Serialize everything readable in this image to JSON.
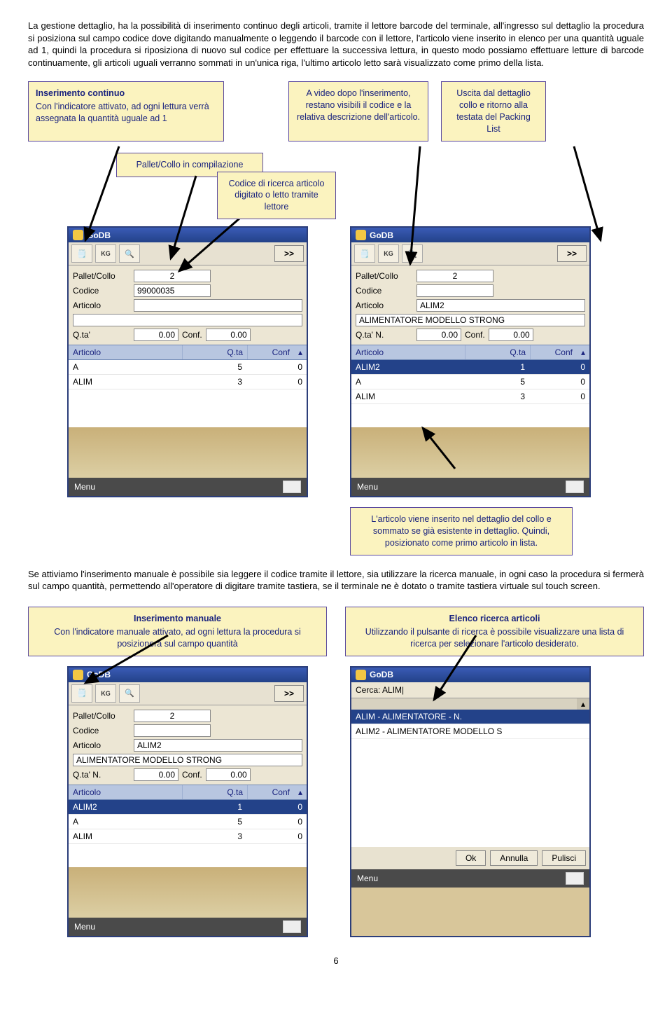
{
  "para1": "La gestione dettaglio, ha la possibilità di inserimento continuo degli articoli, tramite il lettore barcode del terminale, all'ingresso sul dettaglio la procedura si posiziona sul campo codice dove digitando manualmente o leggendo il barcode con il lettore, l'articolo viene inserito in elenco per una quantità uguale ad 1, quindi la procedura si riposiziona di nuovo sul codice per effettuare la successiva lettura, in questo modo possiamo effettuare letture di barcode continuamente, gli articoli uguali verranno sommati in un'unica riga, l'ultimo articolo letto sarà visualizzato come primo della lista.",
  "callouts": {
    "ins_cont_title": "Inserimento continuo",
    "ins_cont_body": "Con l'indicatore attivato, ad ogni lettura verrà assegnata la quantità uguale ad 1",
    "video_body": "A video dopo l'inserimento, restano visibili il codice e la relativa descrizione dell'articolo.",
    "exit_body": "Uscita dal dettaglio collo e ritorno alla testata del Packing List",
    "pallet_comp": "Pallet/Collo in compilazione",
    "codice_ric": "Codice di ricerca articolo digitato o letto tramite lettore",
    "articolo_inserito": "L'articolo viene inserito nel dettaglio del collo e sommato se già esistente in dettaglio. Quindi, posizionato come primo articolo in lista.",
    "ins_man_title": "Inserimento manuale",
    "ins_man_body": "Con l'indicatore manuale attivato, ad ogni lettura la procedura si posizionerà sul campo quantità",
    "elenco_title": "Elenco ricerca articoli",
    "elenco_body": "Utilizzando il pulsante di ricerca è possibile visualizzare una lista di ricerca per selezionare l'articolo desiderato."
  },
  "para2": "Se attiviamo l'inserimento manuale è possibile sia leggere il codice tramite il lettore, sia utilizzare la ricerca manuale, in ogni caso la procedura si fermerà sul campo quantità, permettendo all'operatore di digitare tramite tastiera, se il terminale ne è dotato o tramite tastiera virtuale sul touch screen.",
  "app": {
    "title": "GoDB",
    "next": ">>",
    "kg": "KG",
    "menu": "Menu",
    "labels": {
      "pallet": "Pallet/Collo",
      "codice": "Codice",
      "articolo": "Articolo",
      "qta": "Q.ta'",
      "qtan": "Q.ta' N.",
      "conf": "Conf.",
      "cerca": "Cerca:"
    },
    "cols": {
      "c1": "Articolo",
      "c2": "Q.ta",
      "c3": "Conf"
    }
  },
  "screen1": {
    "pallet": "2",
    "codice": "99000035",
    "articolo": "",
    "desc": "",
    "qta": "0.00",
    "conf": "0.00",
    "rows": [
      {
        "a": "A",
        "q": "5",
        "c": "0"
      },
      {
        "a": "ALIM",
        "q": "3",
        "c": "0"
      }
    ]
  },
  "screen2": {
    "pallet": "2",
    "codice": "",
    "articolo": "ALIM2",
    "desc": "ALIMENTATORE MODELLO STRONG",
    "qta": "0.00",
    "conf": "0.00",
    "rows": [
      {
        "a": "ALIM2",
        "q": "1",
        "c": "0",
        "sel": true
      },
      {
        "a": "A",
        "q": "5",
        "c": "0"
      },
      {
        "a": "ALIM",
        "q": "3",
        "c": "0"
      }
    ]
  },
  "screen3": {
    "pallet": "2",
    "codice": "",
    "articolo": "ALIM2",
    "desc": "ALIMENTATORE MODELLO STRONG",
    "qta": "0.00",
    "conf": "0.00",
    "rows": [
      {
        "a": "ALIM2",
        "q": "1",
        "c": "0",
        "sel": true
      },
      {
        "a": "A",
        "q": "5",
        "c": "0"
      },
      {
        "a": "ALIM",
        "q": "3",
        "c": "0"
      }
    ]
  },
  "screen4": {
    "search": "ALIM",
    "rows": [
      {
        "t": "ALIM - ALIMENTATORE - N.",
        "sel": true
      },
      {
        "t": "ALIM2 - ALIMENTATORE MODELLO S"
      }
    ],
    "buttons": {
      "ok": "Ok",
      "annulla": "Annulla",
      "pulisci": "Pulisci"
    }
  },
  "page": "6"
}
